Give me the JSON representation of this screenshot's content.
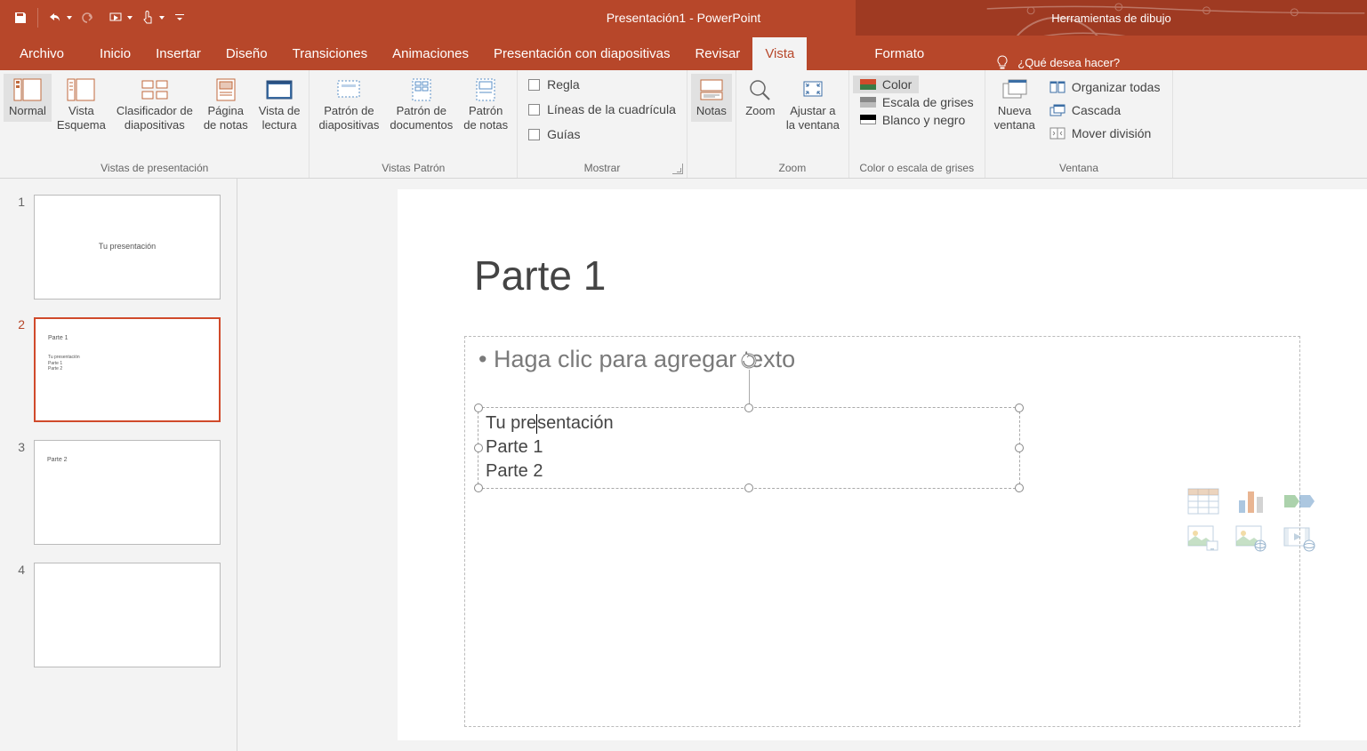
{
  "titlebar": {
    "document": "Presentación1 - PowerPoint",
    "context_tool": "Herramientas de dibujo"
  },
  "tabs": {
    "archivo": "Archivo",
    "inicio": "Inicio",
    "insertar": "Insertar",
    "diseno": "Diseño",
    "transiciones": "Transiciones",
    "animaciones": "Animaciones",
    "presentacion": "Presentación con diapositivas",
    "revisar": "Revisar",
    "vista": "Vista",
    "formato": "Formato",
    "tellme_placeholder": "¿Qué desea hacer?"
  },
  "ribbon": {
    "views": {
      "normal": "Normal",
      "outline": "Vista\nEsquema",
      "sorter": "Clasificador de\ndiapositivas",
      "notes": "Página\nde notas",
      "reading": "Vista de\nlectura",
      "group": "Vistas de presentación"
    },
    "masters": {
      "slide": "Patrón de\ndiapositivas",
      "handout": "Patrón de\ndocumentos",
      "notes": "Patrón\nde notas",
      "group": "Vistas Patrón"
    },
    "show": {
      "ruler": "Regla",
      "grid": "Líneas de la cuadrícula",
      "guides": "Guías",
      "notesbtn": "Notas",
      "group": "Mostrar"
    },
    "zoom": {
      "zoom": "Zoom",
      "fit": "Ajustar a\nla ventana",
      "group": "Zoom"
    },
    "color": {
      "color": "Color",
      "gray": "Escala de grises",
      "bw": "Blanco y negro",
      "group": "Color o escala de grises"
    },
    "window": {
      "new": "Nueva\nventana",
      "arrange": "Organizar todas",
      "cascade": "Cascada",
      "split": "Mover división",
      "group": "Ventana"
    }
  },
  "thumbs": [
    {
      "n": "1",
      "title": "Tu presentación"
    },
    {
      "n": "2",
      "title": "Parte 1",
      "body": "Tu presentación\nParte 1\nParte 2"
    },
    {
      "n": "3",
      "title": "Parte 2"
    },
    {
      "n": "4",
      "title": ""
    }
  ],
  "slide": {
    "title": "Parte 1",
    "placeholder": "Haga clic para agregar texto",
    "textbox": {
      "line1": "Tu presentación",
      "line2": "Parte 1",
      "line3": "Parte 2"
    }
  }
}
